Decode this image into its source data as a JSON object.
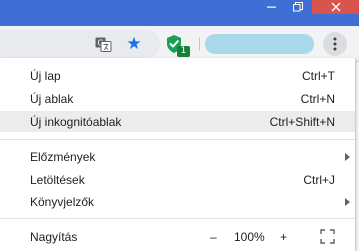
{
  "colors": {
    "accent": "#3f6ed4",
    "close_red": "#d9534f",
    "star": "#1a73e8",
    "profile_chip": "#a8d8ea"
  },
  "window_controls": {
    "minimize_icon": "minimize-icon",
    "restore_icon": "restore-icon",
    "close_icon": "close-icon"
  },
  "toolbar": {
    "translate_icon": "translate-icon",
    "bookmark_icon": "star-icon",
    "extension_icon": "shield-check-icon",
    "extension_badge": "1",
    "menu_icon": "three-dots-vertical-icon"
  },
  "menu": {
    "items": [
      {
        "label": "Új lap",
        "shortcut": "Ctrl+T"
      },
      {
        "label": "Új ablak",
        "shortcut": "Ctrl+N"
      },
      {
        "label": "Új inkognitóablak",
        "shortcut": "Ctrl+Shift+N",
        "highlighted": true
      },
      {
        "label": "Előzmények",
        "submenu": true
      },
      {
        "label": "Letöltések",
        "shortcut": "Ctrl+J"
      },
      {
        "label": "Könyvjelzők",
        "submenu": true
      }
    ],
    "zoom": {
      "label": "Nagyítás",
      "minus": "–",
      "level": "100%",
      "plus": "+",
      "fullscreen_icon": "fullscreen-icon"
    }
  }
}
